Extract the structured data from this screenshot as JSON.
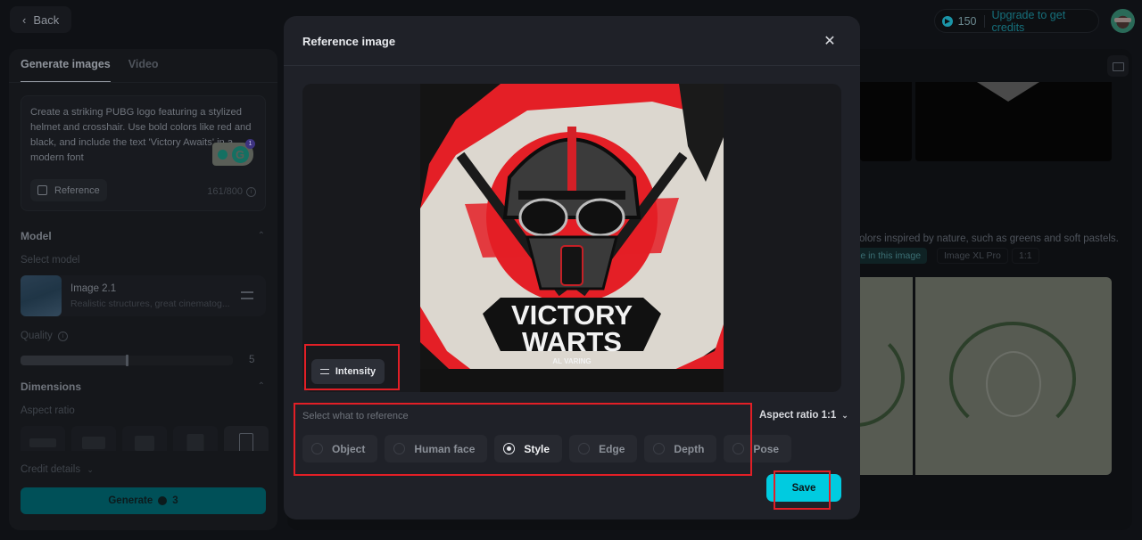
{
  "header": {
    "back_label": "Back",
    "credits_count": "150",
    "upgrade_label": "Upgrade to get credits",
    "accent_color": "#00cbe0"
  },
  "left_panel": {
    "tabs": [
      {
        "label": "Generate images",
        "active": true
      },
      {
        "label": "Video",
        "active": false
      }
    ],
    "prompt": {
      "text": "Create a striking PUBG logo featuring a stylized helmet and crosshair. Use bold colors like red and black, and include the text 'Victory Awaits' in a modern font",
      "reference_label": "Reference",
      "char_count": "161/800",
      "grammarly_badge": "1"
    },
    "model": {
      "section_title": "Model",
      "select_label": "Select model",
      "name": "Image 2.1",
      "description": "Realistic structures, great cinematog..."
    },
    "quality": {
      "label": "Quality",
      "value": "5",
      "fill_fraction": 0.5
    },
    "dimensions": {
      "section_title": "Dimensions",
      "aspect_label": "Aspect ratio",
      "options_count": 5,
      "selected_index": 4
    },
    "credit_details_label": "Credit details",
    "generate": {
      "label": "Generate",
      "cost": "3"
    }
  },
  "background_gallery": {
    "prompt_fragment": "olors inspired by nature, such as greens and soft pastels.",
    "chips": [
      "le in this image",
      "Image XL Pro",
      "1:1"
    ]
  },
  "modal": {
    "title": "Reference image",
    "intensity_label": "Intensity",
    "reference_image_text": {
      "line1": "VICTORY",
      "line2": "WARTS",
      "line3": "AL VARING"
    },
    "select_label": "Select what to reference",
    "options": [
      {
        "label": "Object",
        "selected": false
      },
      {
        "label": "Human face",
        "selected": false
      },
      {
        "label": "Style",
        "selected": true
      },
      {
        "label": "Edge",
        "selected": false
      },
      {
        "label": "Depth",
        "selected": false
      },
      {
        "label": "Pose",
        "selected": false
      }
    ],
    "aspect_ratio_label": "Aspect ratio 1:1",
    "save_label": "Save"
  }
}
